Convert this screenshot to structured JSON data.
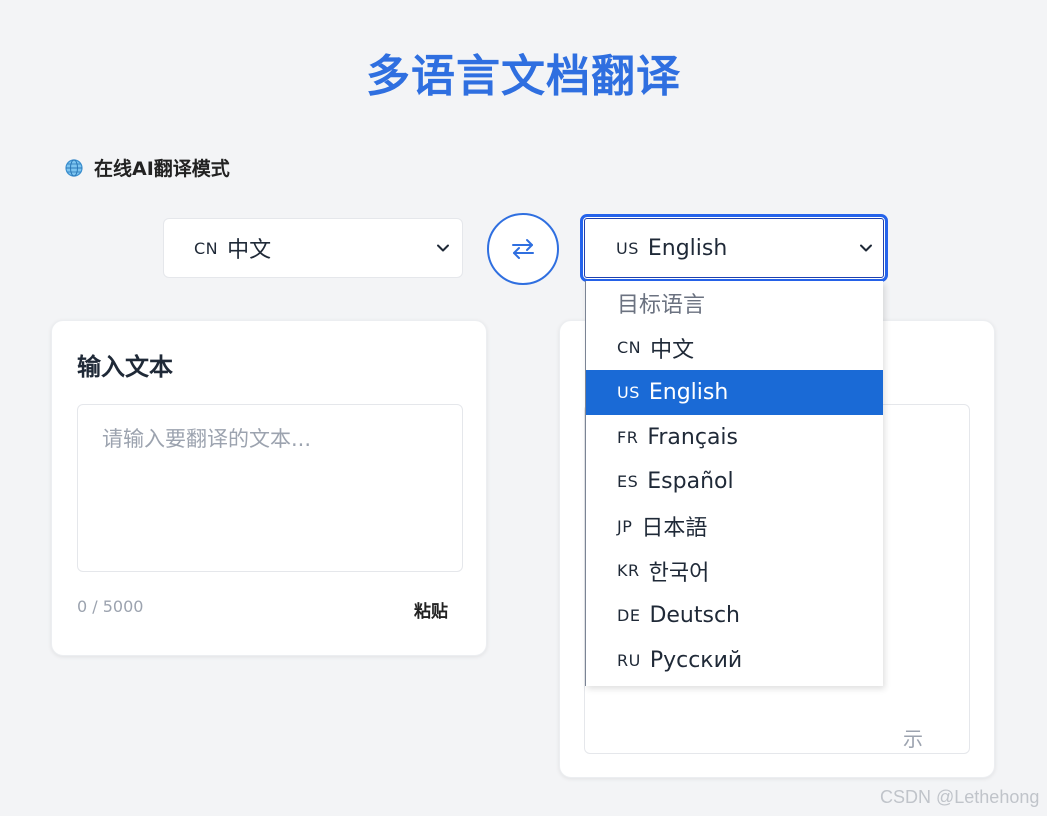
{
  "header": {
    "title": "多语言文档翻译"
  },
  "mode": {
    "label": "在线AI翻译模式",
    "icon": "globe-icon"
  },
  "source_language": {
    "code": "CN",
    "name": "中文",
    "icon": "chevron-down-icon"
  },
  "swap_button": {
    "icon": "swap-arrows-icon"
  },
  "target_language": {
    "code": "US",
    "name": "English",
    "icon": "chevron-down-icon"
  },
  "target_dropdown": {
    "placeholder": "目标语言",
    "options": [
      {
        "code": "CN",
        "name": "中文"
      },
      {
        "code": "US",
        "name": "English",
        "selected": true
      },
      {
        "code": "FR",
        "name": "Français"
      },
      {
        "code": "ES",
        "name": "Español"
      },
      {
        "code": "JP",
        "name": "日本語"
      },
      {
        "code": "KR",
        "name": "한국어"
      },
      {
        "code": "DE",
        "name": "Deutsch"
      },
      {
        "code": "RU",
        "name": "Русский"
      }
    ]
  },
  "input_card": {
    "heading": "输入文本",
    "placeholder": "请输入要翻译的文本...",
    "char_count": "0 / 5000",
    "paste_label": "粘贴"
  },
  "output_card": {
    "partial_hint": "示"
  },
  "watermark": "CSDN @Lethehong",
  "colors": {
    "accent": "#2f6fe0",
    "selected_option": "#1a6ad6",
    "background": "#f3f4f6"
  }
}
